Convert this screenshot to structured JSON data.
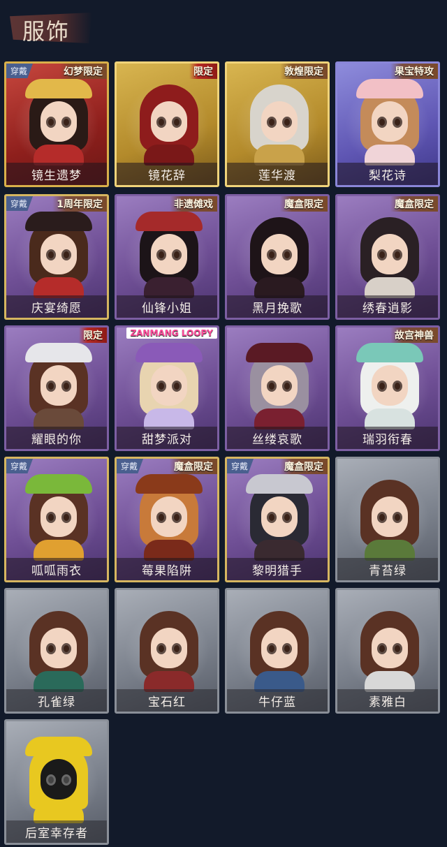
{
  "header": {
    "title": "服饰"
  },
  "cards": [
    {
      "label": "镜生遗梦",
      "style": "red",
      "wear": "穿戴",
      "tag": "幻梦限定",
      "hair": "#2a1a16",
      "body": "#b52c2a",
      "hat": "#e2b84a"
    },
    {
      "label": "镜花辞",
      "style": "gold",
      "wear": "",
      "tag": "限定",
      "hair": "#8e1c1c",
      "body": "#7a1818",
      "hat": ""
    },
    {
      "label": "莲华渡",
      "style": "gold",
      "wear": "",
      "tag": "敦煌限定",
      "hair": "#d8d4cc",
      "body": "#c9a24a",
      "hat": ""
    },
    {
      "label": "梨花诗",
      "style": "blue",
      "wear": "",
      "tag": "果宝特攻",
      "hair": "#c48b5a",
      "body": "#f0d4d8",
      "hat": "#f2c0c6"
    },
    {
      "label": "庆宴绮愿",
      "style": "purple-gold",
      "wear": "穿戴",
      "tag": "1周年限定",
      "hair": "#4a2a1c",
      "body": "#b52c2a",
      "hat": "#2a1c1c"
    },
    {
      "label": "仙锋小姐",
      "style": "purple",
      "wear": "",
      "tag": "非遗傩戏",
      "hair": "#1c1418",
      "body": "#3a2030",
      "hat": "#a52a2a"
    },
    {
      "label": "黑月挽歌",
      "style": "purple",
      "wear": "",
      "tag": "魔盒限定",
      "hair": "#1e1418",
      "body": "#2a1a20",
      "hat": ""
    },
    {
      "label": "绣春逍影",
      "style": "purple",
      "wear": "",
      "tag": "魔盒限定",
      "hair": "#2a2024",
      "body": "#d8d0c8",
      "hat": ""
    },
    {
      "label": "耀眼的你",
      "style": "purple",
      "wear": "",
      "tag": "限定",
      "hair": "#5a3224",
      "body": "#6a4a3a",
      "hat": "#e6e6ea"
    },
    {
      "label": "甜梦派对",
      "style": "purple",
      "wear": "",
      "tag": "ZANMANG LOOPY",
      "hair": "#e8d4b0",
      "body": "#c8b8e8",
      "hat": "#8a5ab8"
    },
    {
      "label": "丝缕哀歌",
      "style": "purple",
      "wear": "",
      "tag": "",
      "hair": "#9a90a0",
      "body": "#7a2030",
      "hat": "#5a1a24"
    },
    {
      "label": "瑞羽衔春",
      "style": "purple",
      "wear": "",
      "tag": "故宫神兽",
      "hair": "#eef0ee",
      "body": "#d8e2e0",
      "hat": "#7ac8b8"
    },
    {
      "label": "呱呱雨衣",
      "style": "purple-gold",
      "wear": "穿戴",
      "tag": "",
      "hair": "#5a3224",
      "body": "#e0a030",
      "hat": "#7ab83a"
    },
    {
      "label": "莓果陷阱",
      "style": "purple-gold",
      "wear": "穿戴",
      "tag": "魔盒限定",
      "hair": "#c87a3a",
      "body": "#7a2a1a",
      "hat": "#8a3a1a"
    },
    {
      "label": "黎明猎手",
      "style": "purple-gold",
      "wear": "穿戴",
      "tag": "魔盒限定",
      "hair": "#2a2a34",
      "body": "#3a2a30",
      "hat": "#c8c8d0"
    },
    {
      "label": "青苔绿",
      "style": "gray",
      "wear": "",
      "tag": "",
      "hair": "#5a3224",
      "body": "#5a7a3a",
      "hat": ""
    },
    {
      "label": "孔雀绿",
      "style": "gray",
      "wear": "",
      "tag": "",
      "hair": "#5a3224",
      "body": "#2a6a5a",
      "hat": ""
    },
    {
      "label": "宝石红",
      "style": "gray",
      "wear": "",
      "tag": "",
      "hair": "#5a3224",
      "body": "#8a2a2a",
      "hat": ""
    },
    {
      "label": "牛仔蓝",
      "style": "gray",
      "wear": "",
      "tag": "",
      "hair": "#5a3224",
      "body": "#3a5a8a",
      "hat": ""
    },
    {
      "label": "素雅白",
      "style": "gray",
      "wear": "",
      "tag": "",
      "hair": "#5a3224",
      "body": "#d8d8d8",
      "hat": ""
    },
    {
      "label": "后室幸存者",
      "style": "gray",
      "wear": "",
      "tag": "",
      "hair": "#e8c820",
      "body": "#e8c820",
      "hat": "#e8c820",
      "mask": true
    }
  ]
}
